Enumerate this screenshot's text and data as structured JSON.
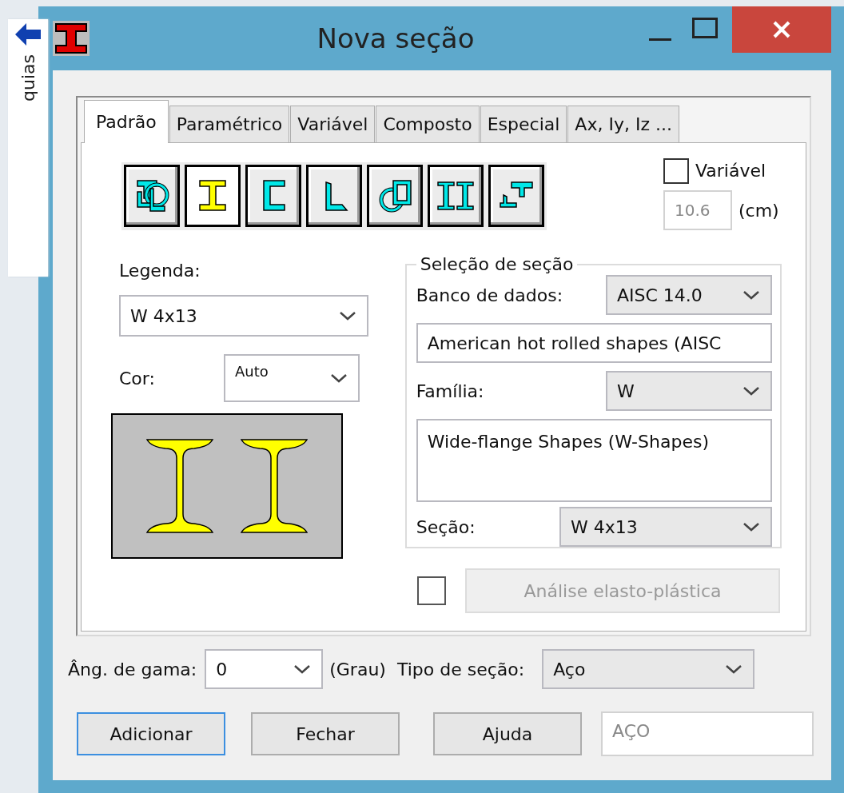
{
  "guide_tab": {
    "label": "quias"
  },
  "window": {
    "title": "Nova seção"
  },
  "tabs": [
    {
      "label": "Padrão",
      "selected": true
    },
    {
      "label": "Paramétrico",
      "selected": false
    },
    {
      "label": "Variável",
      "selected": false
    },
    {
      "label": "Composto",
      "selected": false
    },
    {
      "label": "Especial",
      "selected": false
    },
    {
      "label": "Ax, Iy, Iz ...",
      "selected": false
    }
  ],
  "section_types": [
    {
      "kind": "mixed",
      "selected": false
    },
    {
      "kind": "ibeam",
      "selected": true
    },
    {
      "kind": "channel",
      "selected": false
    },
    {
      "kind": "angle",
      "selected": false
    },
    {
      "kind": "tube",
      "selected": false
    },
    {
      "kind": "double",
      "selected": false
    },
    {
      "kind": "tee",
      "selected": false
    }
  ],
  "variable": {
    "label": "Variável",
    "checked": false,
    "value": "10.6",
    "disabled": true,
    "unit": "(cm)"
  },
  "legend": {
    "label": "Legenda:",
    "value": "W 4x13"
  },
  "color": {
    "label": "Cor:",
    "value": "Auto"
  },
  "selection": {
    "title": "Seleção de seção",
    "database_label": "Banco de dados:",
    "database": "AISC 14.0",
    "database_description": "American hot rolled shapes (AISC",
    "family_label": "Família:",
    "family": "W",
    "family_description": "Wide-flange Shapes (W-Shapes)",
    "section_label": "Seção:",
    "section": "W 4x13"
  },
  "elasto_plastic": {
    "checked": false,
    "label": "Análise elasto-plástica",
    "disabled": true
  },
  "gamma": {
    "label": "Âng. de gama:",
    "value": "0",
    "unit": "(Grau)"
  },
  "section_type": {
    "label": "Tipo de seção:",
    "value": "Aço"
  },
  "buttons": [
    {
      "label": "Adicionar",
      "focused": true
    },
    {
      "label": "Fechar",
      "focused": false
    },
    {
      "label": "Ajuda",
      "focused": false
    }
  ],
  "material_code": {
    "value": "AÇO",
    "disabled": true
  }
}
